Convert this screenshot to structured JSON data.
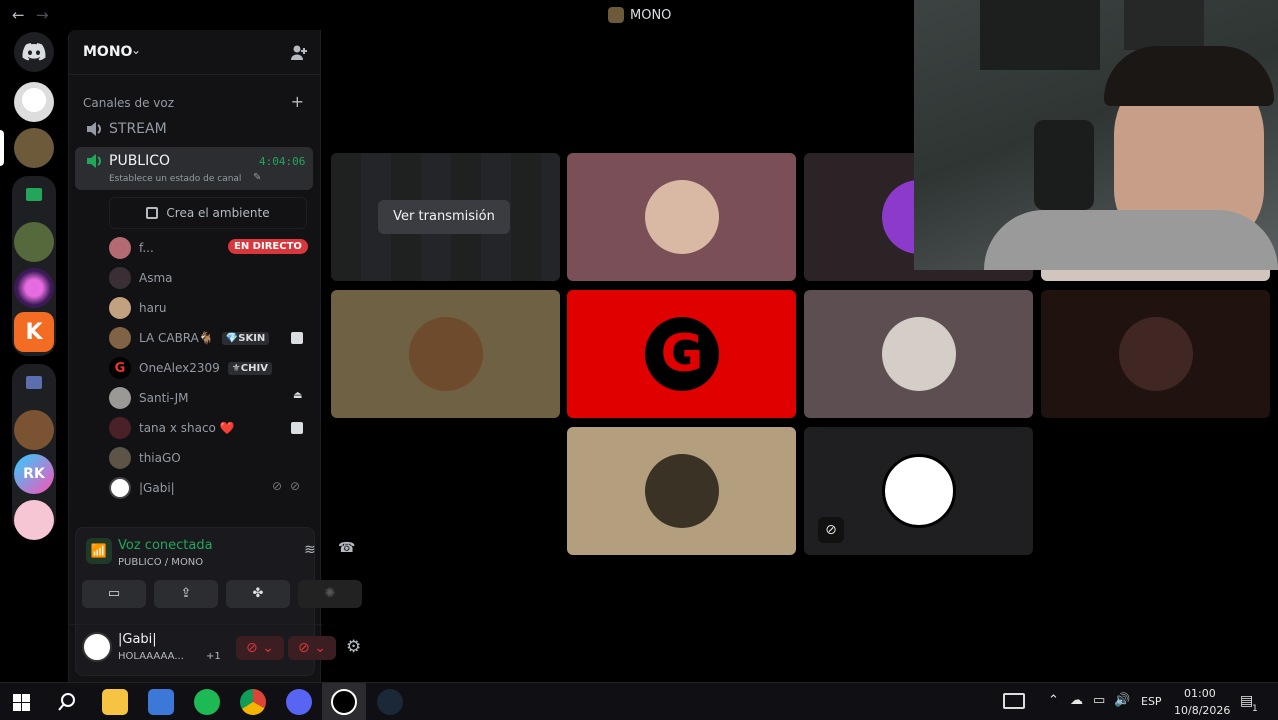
{
  "titlebar": {
    "title": "MONO",
    "back": "←",
    "forward": "→"
  },
  "server": {
    "name": "MONO",
    "category": "Canales de voz",
    "channels": [
      {
        "name": "STREAM"
      },
      {
        "name": "PUBLICO",
        "timer": "4:04:06",
        "status": "Establece un estado de canal"
      }
    ],
    "activity_button": "Crea el ambiente",
    "live_badge": "EN DIRECTO",
    "members": [
      {
        "name": "f..."
      },
      {
        "name": "Asma"
      },
      {
        "name": "haru"
      },
      {
        "name": "LA CABRA🐐",
        "badge": "💎SKIN"
      },
      {
        "name": "OneAlex2309",
        "badge": "⚜CHIV"
      },
      {
        "name": "Santi-JM"
      },
      {
        "name": "tana x shaco ❤️"
      },
      {
        "name": "thiaGO"
      },
      {
        "name": "|Gabi|"
      }
    ]
  },
  "voice_panel": {
    "status": "Voz conectada",
    "location": "PUBLICO / MONO"
  },
  "user_panel": {
    "name": "|Gabi|",
    "status": "HOLAAAAA...",
    "extra": "+1"
  },
  "stage": {
    "stream_button": "Ver transmisión",
    "tile_letter": "G"
  },
  "tray": {
    "language": "ESP",
    "time": "01:00",
    "date": "10/8/2026",
    "notifications": "1"
  },
  "colors": {
    "accent_green": "#23a55a",
    "live_red": "#da373c",
    "brand": "#5865f2"
  }
}
